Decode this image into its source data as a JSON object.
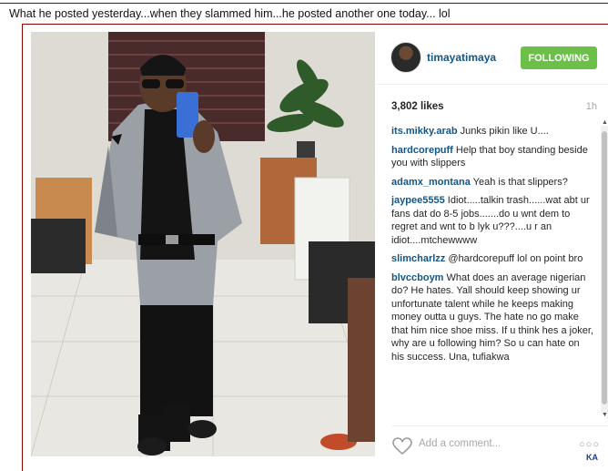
{
  "caption": "What he posted yesterday...when they slammed him...he posted another one today... lol",
  "post": {
    "username": "timayatimaya",
    "follow_label": "FOLLOWING",
    "likes": "3,802 likes",
    "time": "1h",
    "add_comment_placeholder": "Add a comment...",
    "more_icon": "○○○"
  },
  "comments": [
    {
      "user": "its.mikky.arab",
      "text": "Junks pikin like U...."
    },
    {
      "user": "hardcorepuff",
      "text": "Help that boy standing beside you with slippers"
    },
    {
      "user": "adamx_montana",
      "text": "Yeah is that slippers?"
    },
    {
      "user": "jaypee5555",
      "text": "Idiot.....talkin trash......wat abt ur fans dat do 8-5 jobs.......do u wnt dem to regret and wnt to b lyk u???....u r an idiot....mtchewwww"
    },
    {
      "user": "slimcharlzz",
      "text": "@hardcorepuff lol on point bro"
    },
    {
      "user": "blvccboym",
      "text": "What does an average nigerian do? He hates. Yall should keep showing ur unfortunate talent while he keeps making money outta u guys. The hate no go make that him nice shoe miss. If u think hes a joker, why are u following him? So u can hate on his success. Una, tufiakwa"
    }
  ],
  "corner_logo": "KA",
  "icons": [
    "heart-icon",
    "more-options-icon",
    "scroll-up-arrow",
    "scroll-down-arrow"
  ],
  "colors": {
    "link": "#125688",
    "follow_button": "#6cc04a",
    "muted": "#a5a7aa",
    "frame": "#8b0000"
  }
}
